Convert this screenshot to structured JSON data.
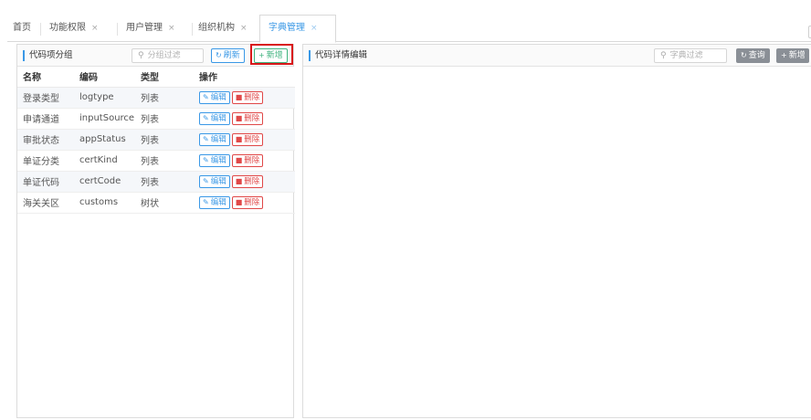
{
  "tabs": [
    {
      "label": "首页",
      "closable": false,
      "active": false
    },
    {
      "label": "功能权限",
      "closable": true,
      "active": false
    },
    {
      "label": "用户管理",
      "closable": true,
      "active": false
    },
    {
      "label": "组织机构",
      "closable": true,
      "active": false
    },
    {
      "label": "字典管理",
      "closable": true,
      "active": true
    }
  ],
  "tab_close_glyph": "×",
  "left_panel": {
    "title": "代码项分组",
    "filter_placeholder": "分组过滤",
    "refresh_label": "刷新",
    "new_label": "新增",
    "columns": [
      "名称",
      "编码",
      "类型",
      "操作"
    ],
    "rows": [
      {
        "name": "登录类型",
        "code": "logtype",
        "type": "列表"
      },
      {
        "name": "申请通道",
        "code": "inputSource",
        "type": "列表"
      },
      {
        "name": "审批状态",
        "code": "appStatus",
        "type": "列表"
      },
      {
        "name": "单证分类",
        "code": "certKind",
        "type": "列表"
      },
      {
        "name": "单证代码",
        "code": "certCode",
        "type": "列表"
      },
      {
        "name": "海关关区",
        "code": "customs",
        "type": "树状"
      }
    ],
    "edit_label": "编辑",
    "delete_label": "删除"
  },
  "right_panel": {
    "title": "代码详情编辑",
    "filter_placeholder": "字典过滤",
    "query_label": "查询",
    "new_label": "新增"
  },
  "colors": {
    "accent": "#3a98e6",
    "new_button": "#3fb37f",
    "delete": "#e04848",
    "highlight": "#d9171a"
  },
  "icons": {
    "refresh": "refresh-icon",
    "plus": "plus-icon",
    "search": "search-icon",
    "edit": "edit-icon",
    "trash": "trash-icon",
    "close": "close-icon"
  }
}
